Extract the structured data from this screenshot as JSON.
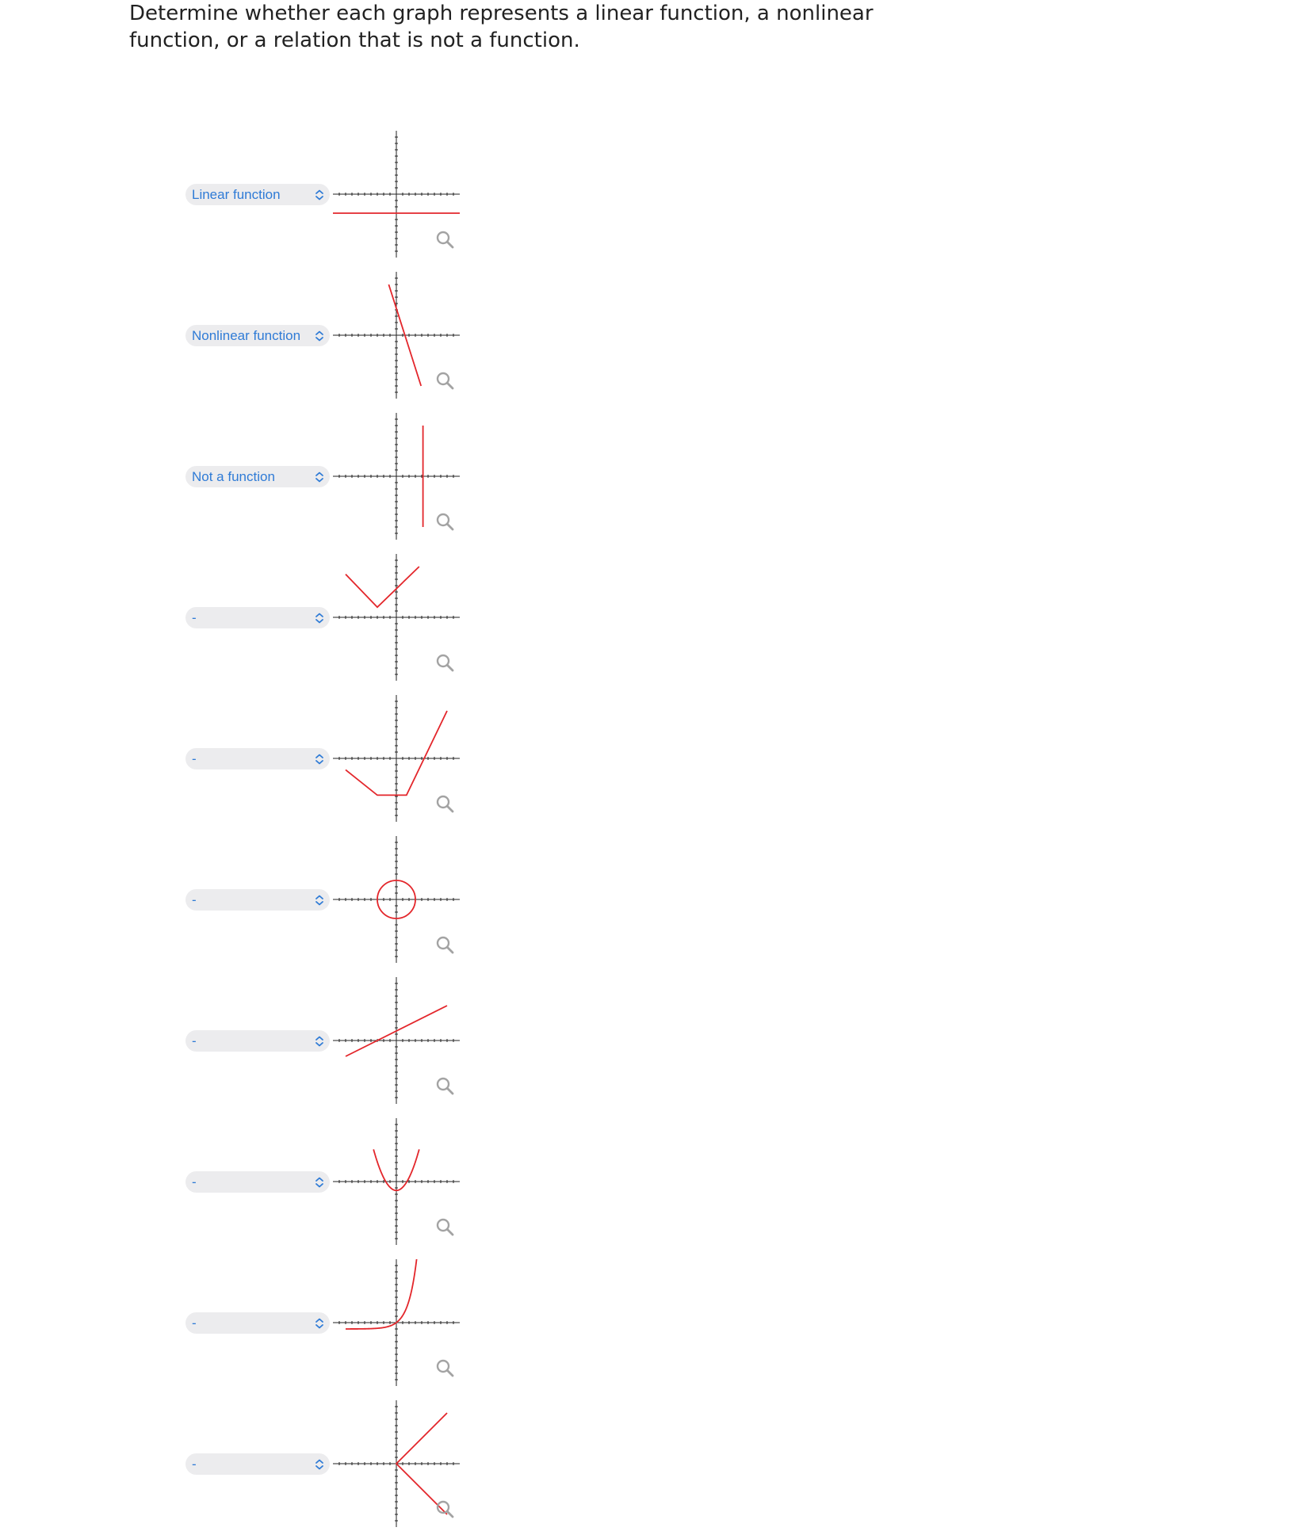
{
  "question": {
    "prompt": "Determine whether each graph represents a linear function, a nonlinear function, or a relation that is not a function."
  },
  "colors": {
    "curve": "#e3262b",
    "axis": "#222222",
    "select_text": "#2f7bd6",
    "select_bg": "#ececee",
    "icon": "#a3a3a3"
  },
  "icons": {
    "select": "chevron-up-down-icon",
    "zoom": "magnifier-icon"
  },
  "items": [
    {
      "selected": "Linear function",
      "graph": "horizontal line below the x-axis"
    },
    {
      "selected": "Nonlinear function",
      "graph": "steep line with negative slope"
    },
    {
      "selected": "Not a function",
      "graph": "vertical line"
    },
    {
      "selected": "-",
      "graph": "absolute value V above the x-axis"
    },
    {
      "selected": "-",
      "graph": "piecewise line with flat segment"
    },
    {
      "selected": "-",
      "graph": "circle centered at origin"
    },
    {
      "selected": "-",
      "graph": "line with positive slope"
    },
    {
      "selected": "-",
      "graph": "parabola opening upward"
    },
    {
      "selected": "-",
      "graph": "exponential growth curve"
    },
    {
      "selected": "-",
      "graph": "sideways V opening right"
    }
  ]
}
